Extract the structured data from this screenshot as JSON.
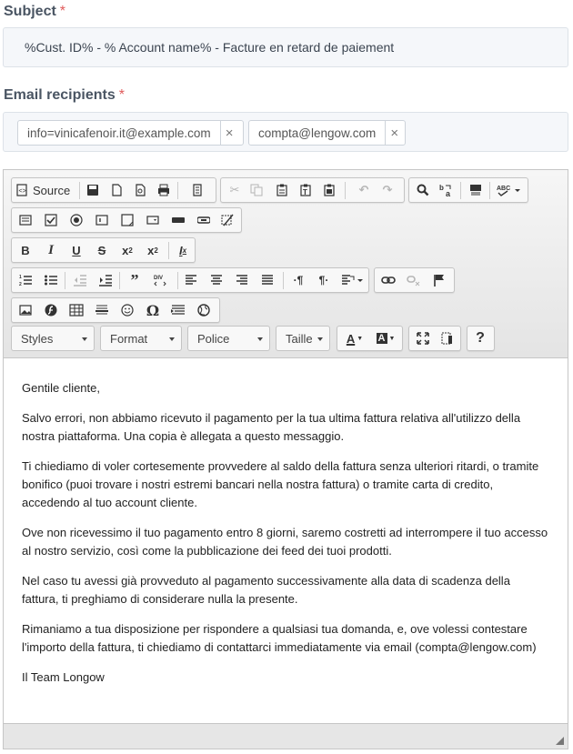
{
  "subject": {
    "label": "Subject",
    "required_mark": "*",
    "value": "%Cust. ID% - % Account name% - Facture en retard de paiement"
  },
  "recipients": {
    "label": "Email recipients",
    "required_mark": "*",
    "chips": [
      "info=vinicafenoir.it@example.com",
      "compta@lengow.com"
    ],
    "remove_glyph": "×"
  },
  "toolbar": {
    "source_label": "Source",
    "styles_label": "Styles",
    "format_label": "Format",
    "font_label": "Police",
    "size_label": "Taille",
    "help_label": "?",
    "text_color_label": "A",
    "bg_color_label": "A"
  },
  "body": {
    "paragraphs": [
      "Gentile cliente,",
      "Salvo errori, non abbiamo ricevuto il pagamento per la tua ultima fattura relativa all'utilizzo della nostra piattaforma. Una copia è allegata a questo messaggio.",
      "Ti chiediamo di voler cortesemente provvedere al saldo della fattura senza ulteriori ritardi, o tramite bonifico (puoi trovare i nostri estremi bancari nella nostra fattura) o tramite carta di credito, accedendo al tuo account cliente.",
      "Ove non ricevessimo il tuo pagamento entro 8 giorni, saremo costretti ad interrompere il tuo accesso al nostro servizio, così come la pubblicazione dei feed dei tuoi prodotti.",
      "Nel caso tu avessi già provveduto al pagamento successivamente alla data di scadenza della fattura, ti preghiamo di considerare nulla la presente.",
      "Rimaniamo a tua disposizione per rispondere a qualsiasi tua domanda, e, ove volessi contestare l'importo della fattura, ti chiediamo di contattarci immediatamente via email (compta@lengow.com)",
      "Il Team Longow"
    ]
  },
  "colors": {
    "label": "#4a5563",
    "required": "#e05a5a",
    "field_bg": "#f5f7fa"
  }
}
